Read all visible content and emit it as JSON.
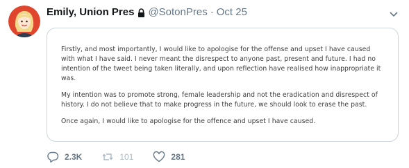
{
  "tweet": {
    "display_name": "Emily, Union Pres",
    "handle": "@SotonPres",
    "separator": "·",
    "timestamp": "Oct 25",
    "image_paragraphs": [
      "Firstly, and most importantly, I would like to apologise for the offense and upset I have caused with what I have said. I never meant the disrespect to anyone past, present and future. I had no intention of the tweet being taken literally, and upon reflection have realised how inappropriate it was.",
      "My intention was to promote strong, female leadership and not the eradication and disrespect of history. I do not believe that to make progress in the future, we should look to erase the past.",
      "Once again, I would like to apologise for the offence and upset I have caused."
    ],
    "actions": {
      "reply_count": "2.3K",
      "retweet_count": "101",
      "like_count": "281"
    }
  },
  "icons": {
    "lock": "lock-icon",
    "chevron": "chevron-down-icon",
    "reply": "reply-icon",
    "retweet": "retweet-icon",
    "like": "heart-icon"
  },
  "colors": {
    "avatar_bg": "#e0452e",
    "muted": "#657786",
    "border": "#ccd6dd"
  }
}
